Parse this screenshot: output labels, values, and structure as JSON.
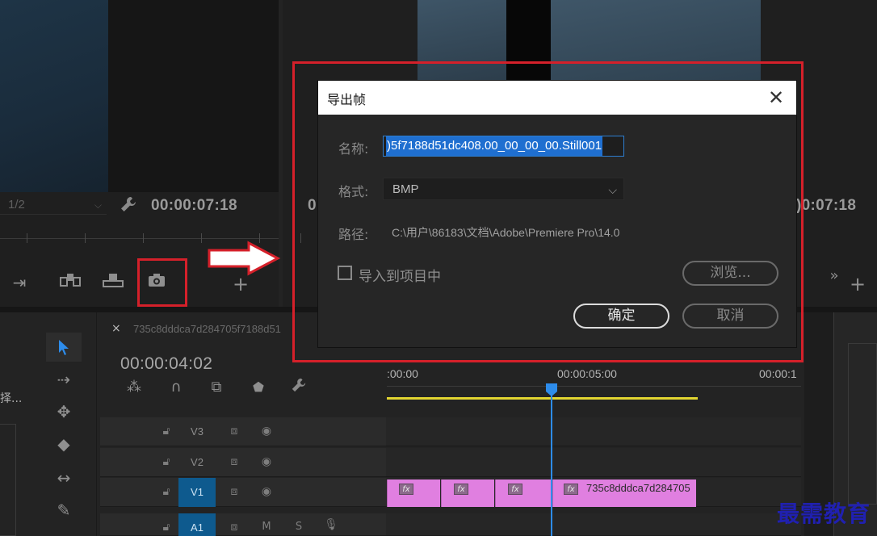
{
  "source_monitor": {
    "zoom": "1/2",
    "timecode": "00:00:07:18"
  },
  "program_monitor": {
    "timecode_partial_left": "0",
    "timecode_partial_right": ")0:07:18"
  },
  "dialog": {
    "title": "导出帧",
    "close_glyph": "✕",
    "name_label": "名称:",
    "name_value": ")5f7188d51dc408.00_00_00_00.Still001",
    "format_label": "格式:",
    "format_value": "BMP",
    "path_label": "路径:",
    "path_value": "C:\\用户\\86183\\文档\\Adobe\\Premiere Pro\\14.0",
    "import_label": "导入到项目中",
    "import_checked": false,
    "browse_label": "浏览...",
    "ok_label": "确定",
    "cancel_label": "取消"
  },
  "timeline": {
    "tab_title": "735c8dddca7d284705f7188d51",
    "close_glyph": "×",
    "timecode": "00:00:04:02",
    "ruler_labels": [
      ":00:00",
      "00:00:05:00",
      "00:00:1"
    ],
    "tracks": [
      {
        "name": "V3",
        "selected": false
      },
      {
        "name": "V2",
        "selected": false
      },
      {
        "name": "V1",
        "selected": true
      },
      {
        "name": "A1",
        "selected": true
      }
    ],
    "audio_m": "M",
    "audio_s": "S",
    "clip_label": "735c8dddca7d284705",
    "fx_label": "fx"
  },
  "left_panel": {
    "truncated_text": "择..."
  },
  "watermark": "最需教育",
  "colors": {
    "annotation_red": "#d5202a",
    "selection_blue": "#1f6fd0",
    "clip_pink": "#e07fe0",
    "playhead_blue": "#2d8ceb",
    "work_area_yellow": "#e2d531"
  }
}
